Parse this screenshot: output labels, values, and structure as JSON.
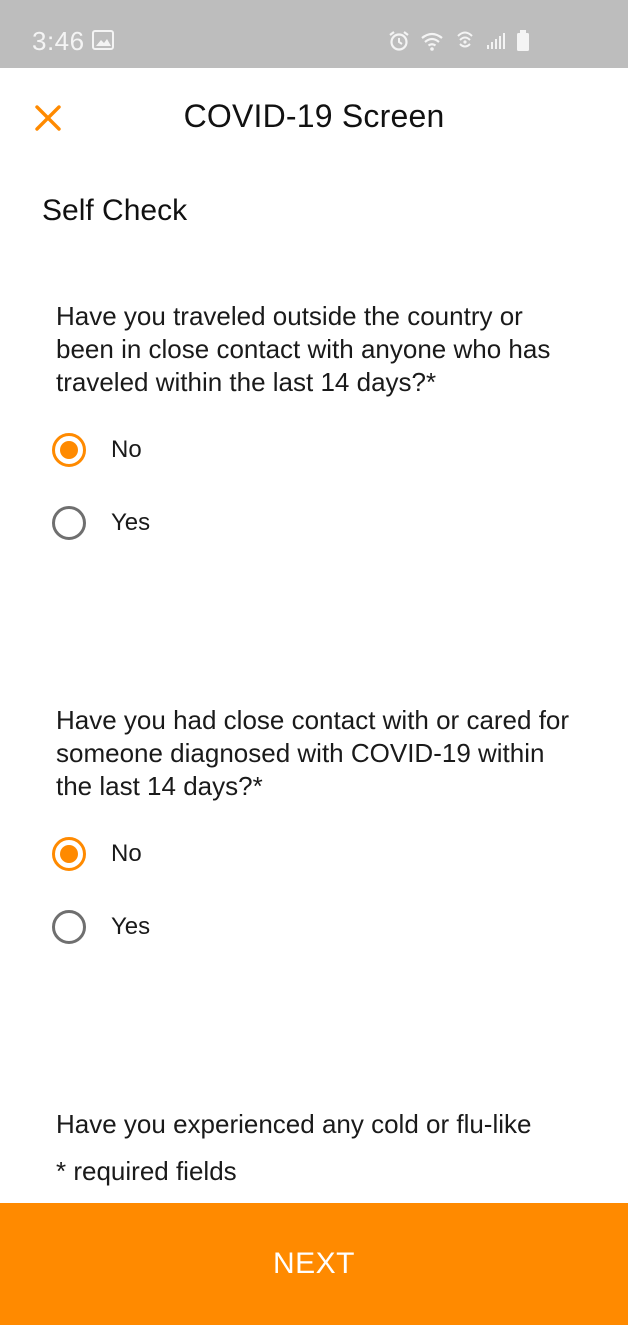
{
  "status_bar": {
    "time": "3:46",
    "icons": [
      "gallery-icon",
      "alarm-icon",
      "wifi-icon",
      "hotspot-icon",
      "signal-icon",
      "battery-icon"
    ]
  },
  "header": {
    "title": "COVID-19 Screen",
    "close_icon": "close-icon"
  },
  "section_title": "Self Check",
  "questions": [
    {
      "text": "Have you traveled outside the country or been in close contact with anyone who has traveled within the last 14 days?*",
      "options": [
        {
          "label": "No",
          "selected": true
        },
        {
          "label": "Yes",
          "selected": false
        }
      ]
    },
    {
      "text": "Have you had close contact with or cared for someone diagnosed with COVID-19 within the last 14 days?*",
      "options": [
        {
          "label": "No",
          "selected": true
        },
        {
          "label": "Yes",
          "selected": false
        }
      ]
    },
    {
      "text": "Have you experienced any cold or flu-like"
    }
  ],
  "required_note": "* required fields",
  "next_button": "NEXT",
  "colors": {
    "accent": "#ff8a00",
    "status_bar": "#bdbdbd",
    "radio_unselected": "#6f6f6f"
  }
}
